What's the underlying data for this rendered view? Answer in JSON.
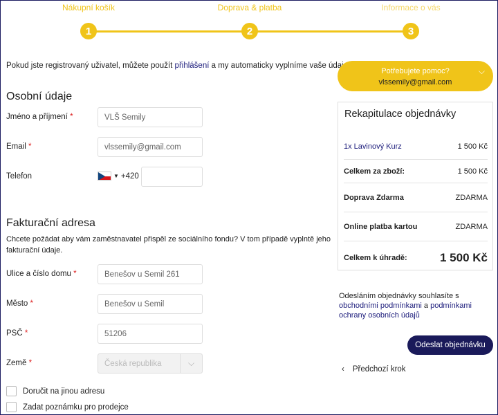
{
  "steps": [
    {
      "label": "Nákupní košík",
      "number": "1"
    },
    {
      "label": "Doprava & platba",
      "number": "2"
    },
    {
      "label": "Informace o vás",
      "number": "3"
    }
  ],
  "intro": {
    "before": "Pokud jste registrovaný uživatel, můžete použít ",
    "link": "přihlášení",
    "after": " a my automaticky vyplníme vaše údaje."
  },
  "personal": {
    "title": "Osobní údaje",
    "name_label": "Jméno a příjmení",
    "name_value": "VLŠ Semily",
    "email_label": "Email",
    "email_value": "vlssemily@gmail.com",
    "phone_label": "Telefon",
    "phone_prefix": "+420",
    "phone_value": ""
  },
  "billing": {
    "title": "Fakturační adresa",
    "note": "Chcete požádat aby vám zaměstnavatel přispěl ze sociálního fondu? V tom případě vyplntě jeho fakturační údaje.",
    "street_label": "Ulice a číslo domu",
    "street_value": "Benešov u Semil 261",
    "city_label": "Město",
    "city_value": "Benešov u Semil",
    "zip_label": "PSČ",
    "zip_value": "51206",
    "country_label": "Země",
    "country_value": "Česká republika"
  },
  "required_mark": "*",
  "checkboxes": {
    "other_address": "Doručit na jinou adresu",
    "seller_note": "Zadat poznámku pro prodejce"
  },
  "help": {
    "title": "Potřebujete pomoc?",
    "email": "vlssemily@gmail.com"
  },
  "summary": {
    "title": "Rekapitulace objednávky",
    "item_label": "1x Lavinový Kurz",
    "item_value": "1 500 Kč",
    "goods_label": "Celkem za zboží:",
    "goods_value": "1 500 Kč",
    "shipping_label": "Doprava Zdarma",
    "shipping_value": "ZDARMA",
    "payment_label": "Online platba kartou",
    "payment_value": "ZDARMA",
    "total_label": "Celkem k úhradě:",
    "total_value": "1 500 Kč"
  },
  "terms": {
    "before": "Odesláním objednávky souhlasíte s ",
    "link1": "obchodními podmínkami",
    "middle": " a ",
    "link2": "podmínkami ochrany osobních údajů"
  },
  "actions": {
    "submit": "Odeslat objednávku",
    "back": "Předchozí krok"
  },
  "colors": {
    "accent": "#f0c419",
    "primary": "#1a1a5a",
    "required": "#dd2222"
  }
}
